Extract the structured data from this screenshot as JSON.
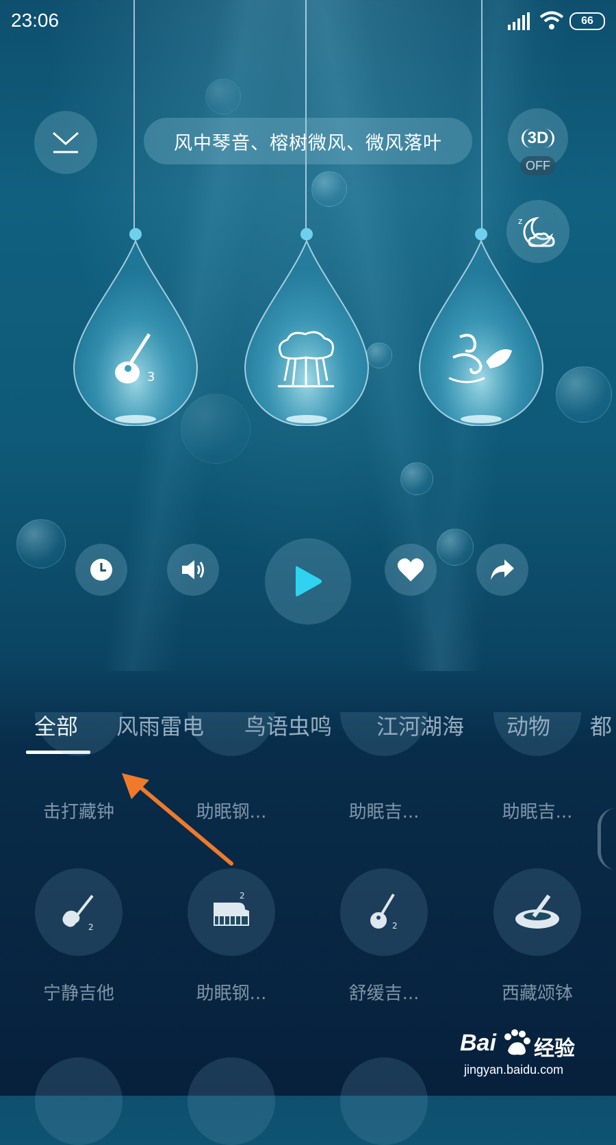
{
  "status_bar": {
    "time": "23:06",
    "battery": "66"
  },
  "header": {
    "title": "风中琴音、榕树微风、微风落叶",
    "three_d_label": "3D",
    "three_d_state": "OFF"
  },
  "drops": [
    {
      "icon": "guitar-icon",
      "badge": "3"
    },
    {
      "icon": "banyan-tree-icon",
      "badge": ""
    },
    {
      "icon": "wind-leaf-icon",
      "badge": ""
    }
  ],
  "controls": {
    "accent": "#2fd3f0",
    "items": [
      "timer-icon",
      "volume-icon",
      "play-icon",
      "heart-icon",
      "share-icon"
    ]
  },
  "tabs": [
    "全部",
    "风雨雷电",
    "鸟语虫鸣",
    "江河湖海",
    "动物",
    "都"
  ],
  "active_tab": "全部",
  "grid_row1_labels": [
    "击打藏钟",
    "助眠钢...",
    "助眠吉...",
    "助眠吉..."
  ],
  "grid_row2": [
    {
      "label": "宁静吉他",
      "icon": "electric-guitar-icon",
      "badge": "2"
    },
    {
      "label": "助眠钢...",
      "icon": "piano-icon",
      "badge": "2"
    },
    {
      "label": "舒缓吉...",
      "icon": "acoustic-guitar-icon",
      "badge": "2"
    },
    {
      "label": "西藏颂钵",
      "icon": "singing-bowl-icon",
      "badge": ""
    }
  ],
  "watermark": {
    "brand": "Bai",
    "brand2": "经验",
    "url": "jingyan.baidu.com"
  }
}
